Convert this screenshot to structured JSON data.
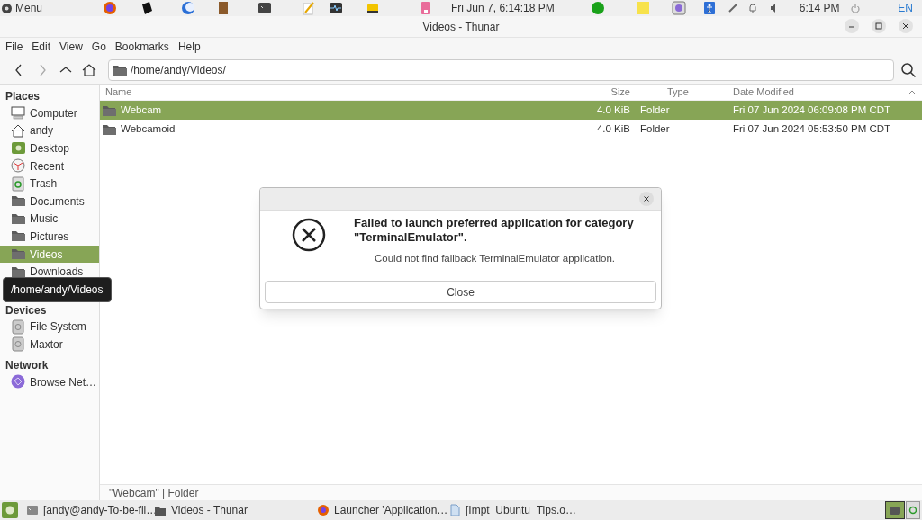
{
  "top_panel": {
    "menu": "Menu",
    "clock": "Fri Jun  7,  6:14:18 PM",
    "time": "6:14 PM",
    "language": "EN"
  },
  "window": {
    "title": "Videos - Thunar"
  },
  "menubar": [
    "File",
    "Edit",
    "View",
    "Go",
    "Bookmarks",
    "Help"
  ],
  "location": {
    "value": "/home/andy/Videos/"
  },
  "sidebar": [
    {
      "heading": "Places",
      "items": [
        {
          "label": "Computer",
          "kind": "computer",
          "selected": false
        },
        {
          "label": "andy",
          "kind": "home",
          "selected": false
        },
        {
          "label": "Desktop",
          "kind": "desktop",
          "selected": false
        },
        {
          "label": "Recent",
          "kind": "recent",
          "selected": false
        },
        {
          "label": "Trash",
          "kind": "trash",
          "selected": false
        },
        {
          "label": "Documents",
          "kind": "folder",
          "selected": false
        },
        {
          "label": "Music",
          "kind": "folder",
          "selected": false
        },
        {
          "label": "Pictures",
          "kind": "folder",
          "selected": false
        },
        {
          "label": "Videos",
          "kind": "folder",
          "selected": true
        },
        {
          "label": "Downloads",
          "kind": "folder",
          "selected": false
        }
      ]
    },
    {
      "heading": "Devices",
      "items": [
        {
          "label": "File System",
          "kind": "drive",
          "selected": false
        },
        {
          "label": "Maxtor",
          "kind": "drive",
          "selected": false
        }
      ]
    },
    {
      "heading": "Network",
      "items": [
        {
          "label": "Browse Net…",
          "kind": "network",
          "selected": false
        }
      ]
    }
  ],
  "tooltip": "/home/andy/Videos",
  "table": {
    "columns": [
      "Name",
      "Size",
      "Type",
      "Date Modified"
    ],
    "rows": [
      {
        "name": "Webcam",
        "size": "4.0 KiB",
        "type": "Folder",
        "date": "Fri 07 Jun 2024 06:09:08 PM CDT",
        "selected": true
      },
      {
        "name": "Webcamoid",
        "size": "4.0 KiB",
        "type": "Folder",
        "date": "Fri 07 Jun 2024 05:53:50 PM CDT",
        "selected": false
      }
    ]
  },
  "status_bar": "\"Webcam\" | Folder",
  "dialog": {
    "title": "Failed to launch preferred application for category \"TerminalEmulator\".",
    "message": "Could not find fallback TerminalEmulator application.",
    "button": "Close"
  },
  "taskbar": [
    {
      "label": "[andy@andy-To-be-fil…",
      "kind": "terminal"
    },
    {
      "label": "Videos - Thunar",
      "kind": "folder"
    },
    {
      "label": "Launcher 'Application…",
      "kind": "browser"
    },
    {
      "label": "[Impt_Ubuntu_Tips.o…",
      "kind": "document"
    }
  ]
}
